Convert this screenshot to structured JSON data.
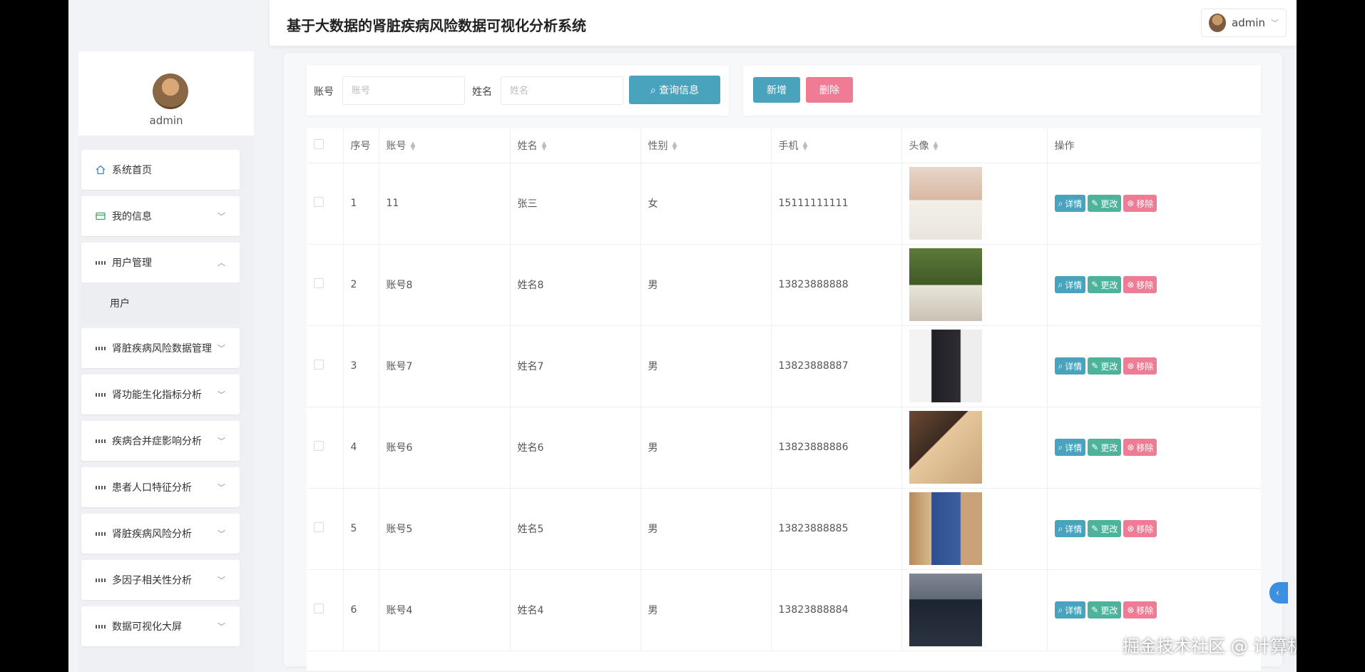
{
  "header": {
    "title": "基于大数据的肾脏疾病风险数据可视化分析系统",
    "user": "admin"
  },
  "sidebar": {
    "username": "admin",
    "items": [
      {
        "label": "系统首页",
        "icon": "home-icon"
      },
      {
        "label": "我的信息",
        "icon": "card-icon"
      },
      {
        "label": "用户管理",
        "icon": "grid-icon"
      },
      {
        "label": "肾脏疾病风险数据管理",
        "icon": "grid-icon"
      },
      {
        "label": "肾功能生化指标分析",
        "icon": "grid-icon"
      },
      {
        "label": "疾病合并症影响分析",
        "icon": "grid-icon"
      },
      {
        "label": "患者人口特征分析",
        "icon": "grid-icon"
      },
      {
        "label": "肾脏疾病风险分析",
        "icon": "grid-icon"
      },
      {
        "label": "多因子相关性分析",
        "icon": "grid-icon"
      },
      {
        "label": "数据可视化大屏",
        "icon": "grid-icon"
      }
    ],
    "submenu": {
      "label": "用户"
    }
  },
  "search": {
    "account_label": "账号",
    "account_placeholder": "账号",
    "name_label": "姓名",
    "name_placeholder": "姓名",
    "query_button": "查询信息"
  },
  "actions": {
    "add": "新增",
    "delete": "删除"
  },
  "table": {
    "headers": [
      "序号",
      "账号",
      "姓名",
      "性别",
      "手机",
      "头像",
      "操作"
    ],
    "op_labels": {
      "detail": "详情",
      "edit": "更改",
      "remove": "移除"
    },
    "rows": [
      {
        "index": "1",
        "account": "11",
        "name": "张三",
        "gender": "女",
        "phone": "15111111111"
      },
      {
        "index": "2",
        "account": "账号8",
        "name": "姓名8",
        "gender": "男",
        "phone": "13823888888"
      },
      {
        "index": "3",
        "account": "账号7",
        "name": "姓名7",
        "gender": "男",
        "phone": "13823888887"
      },
      {
        "index": "4",
        "account": "账号6",
        "name": "姓名6",
        "gender": "男",
        "phone": "13823888886"
      },
      {
        "index": "5",
        "account": "账号5",
        "name": "姓名5",
        "gender": "男",
        "phone": "13823888885"
      },
      {
        "index": "6",
        "account": "账号4",
        "name": "姓名4",
        "gender": "男",
        "phone": "13823888884"
      }
    ]
  },
  "watermark": "掘金技术社区 @ 计算机毕业设计小途",
  "colors": {
    "primary": "#4aa3bd",
    "edit": "#4db39a",
    "danger": "#f07b95"
  }
}
